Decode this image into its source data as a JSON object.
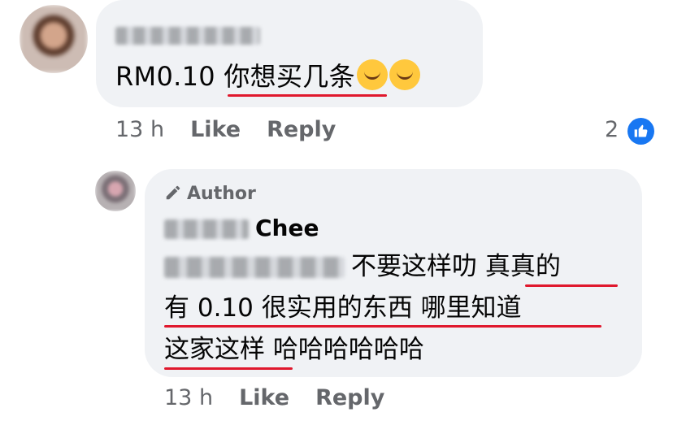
{
  "comment": {
    "text": "RM0.10 你想买几条",
    "emojis": [
      "rolling-on-floor-laughing-icon",
      "face-with-hand-over-mouth-icon"
    ],
    "time": "13 h",
    "like_label": "Like",
    "reply_label": "Reply",
    "reaction_count": "2"
  },
  "reply": {
    "author_badge": "Author",
    "name": "Chee",
    "line1": "不要这样叻 真真的",
    "line2": "有 0.10 很实用的东西 哪里知道",
    "line3": "这家这样 哈哈哈哈哈哈",
    "time": "13 h",
    "like_label": "Like",
    "reply_label": "Reply"
  },
  "colors": {
    "bubble": "#f0f2f5",
    "meta": "#65676b",
    "like_blue": "#1877f2",
    "underline": "#e0182d"
  }
}
